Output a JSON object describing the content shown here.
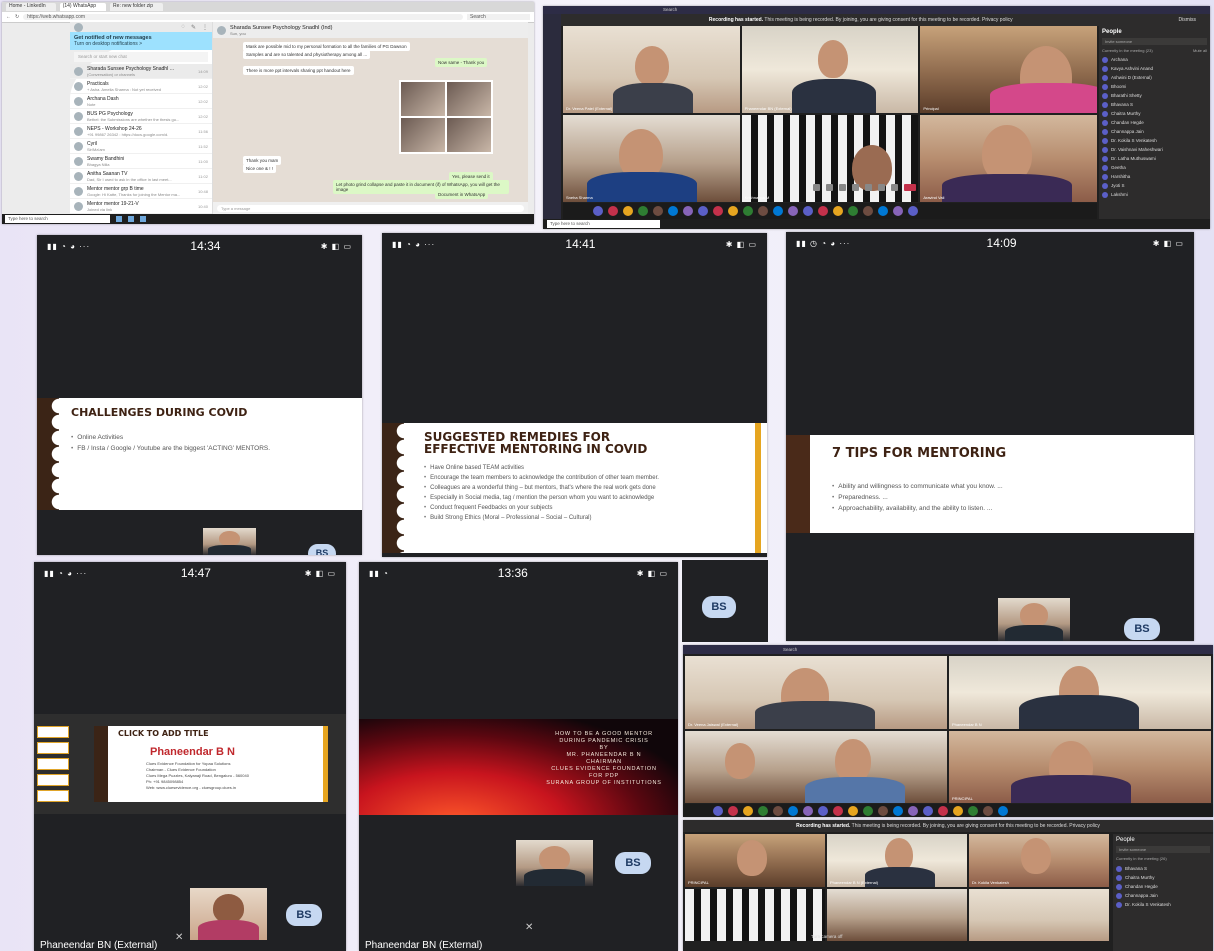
{
  "whatsapp": {
    "tabs": [
      "Home - LinkedIn",
      "(14) WhatsApp",
      "Re: new folder zip"
    ],
    "url": "https://web.whatsapp.com",
    "search_box": "Search",
    "notify_title": "Get notified of new messages",
    "notify_sub": "Turn on desktop notifications >",
    "search_chats": "Search or start new chat",
    "chats": [
      {
        "name": "Sharada Sunsee Psychology SnadhI ...",
        "preview": "(Conversation) or channels",
        "time": "14:09"
      },
      {
        "name": "Practicals",
        "preview": "+ Asha. Amelia Sharma : Not yet received",
        "time": "12:02"
      },
      {
        "name": "Archana Dash",
        "preview": "Note",
        "time": "12:02"
      },
      {
        "name": "BUS PG Psychology",
        "preview": "Bethel: the Submissions are whether the thesis gu...",
        "time": "12:02"
      },
      {
        "name": "NEPS - Workshop 24-26",
        "preview": "+91 99867 26342 : https://docs.google.com/d.",
        "time": "11:56"
      },
      {
        "name": "Cyril",
        "preview": "Sir/Ma'am",
        "time": "11:52"
      },
      {
        "name": "Swamy Bandhini",
        "preview": "Bhagya Nilia",
        "time": "11:00"
      },
      {
        "name": "Anitha Saanan TV",
        "preview": "Dad, Sir I used to ask in the office in last meet...",
        "time": "11:02"
      },
      {
        "name": "Mentor mentor grp B time",
        "preview": "Google: Hi Katte, Thanks for joining the Mentor ma...",
        "time": "10:48"
      },
      {
        "name": "Mentor mentor 19-21-V",
        "preview": "Joined via link",
        "time": "10:40"
      }
    ],
    "conv_title": "Sharada Sunsee Psychology SnadhI (Ind)",
    "conv_sub": "Sun, you",
    "msgs": [
      "Mask are possible mid to my personal formation to all the families of PG Dawson",
      "Samples and are so talented and physiotherapy among all ...",
      "Now same - Thank you",
      "There is more ppt intervals sharing ppt handout here",
      "Thank you mam",
      "Nice one & ! !",
      "Thank you mam",
      "Yes, please send it",
      "Let photo grind collapse and paste it in document (if) of WhatsApp, you will get the image",
      "Document in WhatsApp"
    ],
    "compose_placeholder": "Type a message",
    "taskbar_search": "Type here to search"
  },
  "teams_main": {
    "window_title": "Search",
    "recording_prefix": "Recording has started.",
    "recording_msg": "This meeting is being recorded. By joining, you are giving consent for this meeting to be recorded. Privacy policy",
    "dismiss": "Dismiss",
    "people_title": "People",
    "invite_placeholder": "Invite someone",
    "meeting_count": "Currently in the meeting (23)",
    "mute_all": "Mute all",
    "names": [
      "Aravind Vali",
      "Dr. Veena Patel (External)",
      "Phaneendar BN (External)",
      "Sneha Sharma",
      "Krishnappa M",
      "Principal"
    ],
    "people": [
      "Archana",
      "Kavya Ashvini Anand",
      "Ashwini D (External)",
      "Bhoomi",
      "Bharathi Shetty",
      "Bhavana S",
      "Chaitra Murthy",
      "Chandan Hegde",
      "Channappa Jain",
      "Dr. Kokila S Venkatesh",
      "Dr. Vaishnavi Maheshwari",
      "Dr. Latha Muthuswami",
      "Geetha",
      "Harshitha",
      "Jyoti S",
      "Lakshmi"
    ],
    "taskbar_search": "Type here to search"
  },
  "slides": [
    {
      "time": "14:34",
      "title": "CHALLENGES DURING COVID",
      "bullets": [
        "Online Activities",
        "FB / Insta / Google / Youtube are the biggest 'ACTING' MENTORS."
      ]
    },
    {
      "time": "14:41",
      "title_l1": "SUGGESTED REMEDIES FOR",
      "title_l2": "EFFECTIVE MENTORING IN COVID",
      "bullets": [
        "Have Online based TEAM activities",
        "Encourage the team members to acknowledge the contribution of other team member.",
        "Colleagues are a wonderful thing – but mentors, that's where the real work gets done",
        "Especially in Social media, tag / mention the person whom you want to acknowledge",
        "Conduct frequent Feedbacks on your subjects",
        "Build Strong Ethics (Moral – Professional – Social – Cultural)"
      ]
    },
    {
      "time": "14:09",
      "title": "7 TIPS FOR MENTORING",
      "bullets": [
        "Ability and willingness to communicate what you know. ...",
        "Preparedness. ...",
        "Approachability, availability, and the ability to listen. ..."
      ]
    }
  ],
  "ppt_slide": {
    "time": "14:47",
    "title": "CLICK TO ADD TITLE",
    "name": "Phaneendar B N",
    "lines": [
      "Clues Evidence Foundation for Yopaa Solutions",
      "Chairman - Clues Evidence Foundation",
      "Clues Mega Puzzles, Kalyanaji Road, Bengaluru - 560040",
      "Ph: +91 9845098854",
      "Web: www.cluesevidence.org - cluesgroup.clues.in"
    ],
    "footer": "Phaneendar BN (External)"
  },
  "globe_slide": {
    "time": "13:36",
    "lines": [
      "HOW TO BE A GOOD MENTOR",
      "DURING PANDEMIC CRISIS",
      "BY",
      "MR. PHANEENDAR B N",
      "CHAIRMAN",
      "CLUES EVIDENCE FOUNDATION",
      "FOR PDP",
      "SURANA GROUP OF INSTITUTIONS"
    ],
    "footer": "Phaneendar BN (External)"
  },
  "common": {
    "bs": "BS"
  },
  "teams_small": {
    "window_title": "Search",
    "names": [
      "Dr. Veena Jaiswal (External)",
      "Phaneendar B N",
      "",
      "PRINCIPAL"
    ]
  },
  "teams_bottom": {
    "recording_prefix": "Recording has started.",
    "recording_msg": "This meeting is being recorded. By joining, you are giving consent for this meeting to be recorded. Privacy policy",
    "people_title": "People",
    "invite_placeholder": "Invite someone",
    "meeting_count": "Currently in the meeting (26)",
    "people": [
      "Bhavana S",
      "Chaitra Murthy",
      "Chandan Hegde",
      "Channappa Jain",
      "Dr. Kokila S Venkatesh"
    ],
    "names": [
      "PRINCIPAL",
      "Phaneendar B N (External)",
      "Dr. Kokila Venkatesh"
    ],
    "turn_camera_off": "Turn camera off"
  },
  "colors": {
    "slide_title": "#3e2213",
    "gold_bar": "#e6a520",
    "teams_bg": "#202020",
    "bs_badge": "#c6d8f1",
    "hangup": "#c4314b"
  }
}
